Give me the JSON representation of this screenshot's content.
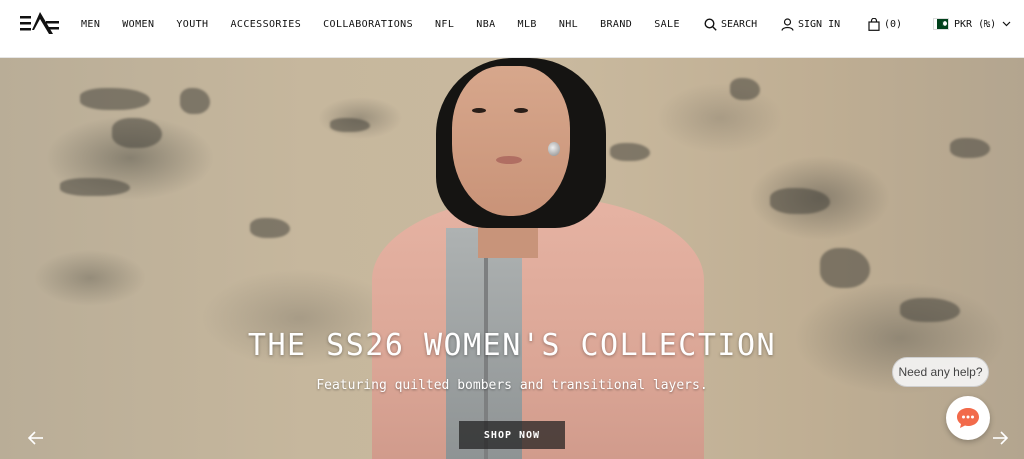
{
  "header": {
    "logo_alt": "Alpha Industries",
    "nav_items": [
      "MEN",
      "WOMEN",
      "YOUTH",
      "ACCESSORIES",
      "COLLABORATIONS",
      "NFL",
      "NBA",
      "MLB",
      "NHL",
      "BRAND",
      "SALE"
    ],
    "search_label": "SEARCH",
    "signin_label": "SIGN IN",
    "cart_label": "(0)",
    "currency_label": "PKR (₨)"
  },
  "hero": {
    "title": "THE SS26 WOMEN'S COLLECTION",
    "subtitle": "Featuring quilted bombers and transitional layers.",
    "cta_label": "SHOP NOW",
    "prev_icon": "arrow-left-icon",
    "next_icon": "arrow-right-icon"
  },
  "chat": {
    "help_text": "Need any help?",
    "chat_icon": "chat-bubble-icon",
    "accent_color": "#f26a4b"
  }
}
